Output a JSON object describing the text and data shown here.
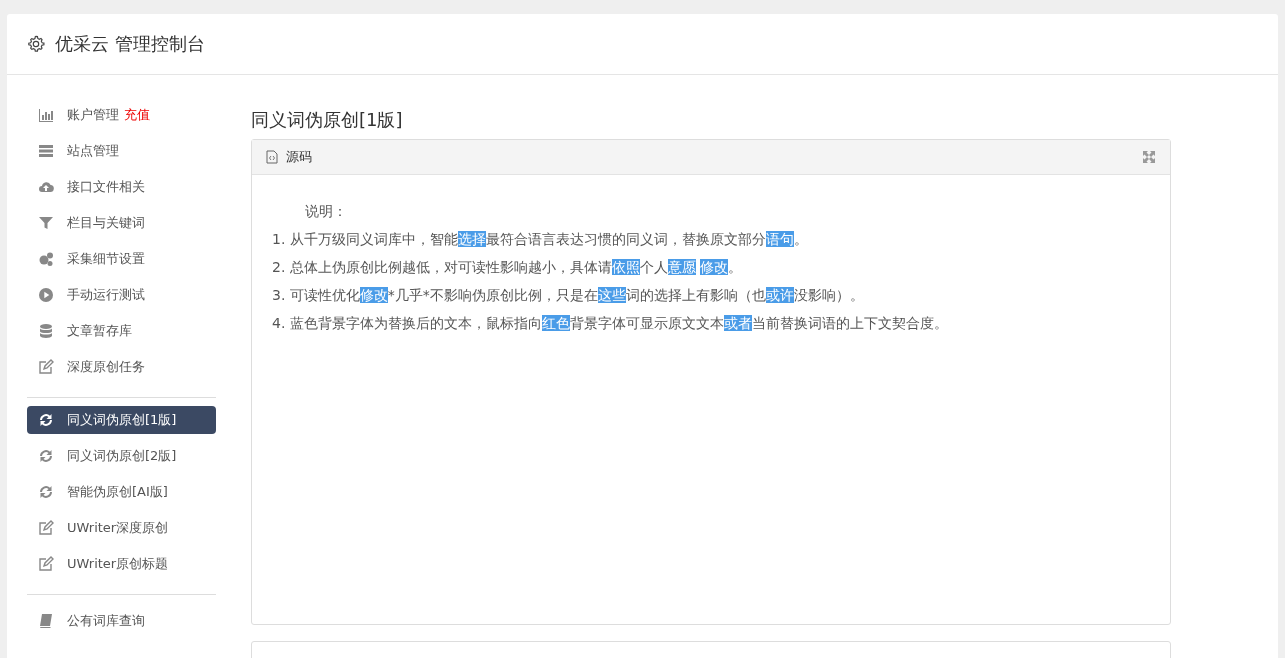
{
  "header": {
    "title": "优采云 管理控制台"
  },
  "sidebar": {
    "groups": [
      {
        "items": [
          {
            "label": "账户管理",
            "badge": "充值",
            "selected": false
          },
          {
            "label": "站点管理",
            "selected": false
          },
          {
            "label": "接口文件相关",
            "selected": false
          },
          {
            "label": "栏目与关键词",
            "selected": false
          },
          {
            "label": "采集细节设置",
            "selected": false
          },
          {
            "label": "手动运行测试",
            "selected": false
          },
          {
            "label": "文章暂存库",
            "selected": false
          },
          {
            "label": "深度原创任务",
            "selected": false
          }
        ]
      },
      {
        "items": [
          {
            "label": "同义词伪原创[1版]",
            "selected": true
          },
          {
            "label": "同义词伪原创[2版]",
            "selected": false
          },
          {
            "label": "智能伪原创[AI版]",
            "selected": false
          },
          {
            "label": "UWriter深度原创",
            "selected": false
          },
          {
            "label": "UWriter原创标题",
            "selected": false
          }
        ]
      },
      {
        "items": [
          {
            "label": "公有词库查询",
            "selected": false
          }
        ]
      }
    ]
  },
  "main": {
    "title": "同义词伪原创[1版]",
    "panel": {
      "title": "源码",
      "heading": "说明：",
      "lines": [
        [
          {
            "text": "1. 从千万级同义词库中，智能",
            "highlighted": false
          },
          {
            "text": "选择",
            "highlighted": true
          },
          {
            "text": "最符合语言表达习惯的同义词，替换原文部分",
            "highlighted": false
          },
          {
            "text": "语句",
            "highlighted": true
          },
          {
            "text": "。",
            "highlighted": false
          }
        ],
        [
          {
            "text": "2. 总体上伪原创比例越低，对可读性影响越小，具体请",
            "highlighted": false
          },
          {
            "text": "依照",
            "highlighted": true
          },
          {
            "text": "个人",
            "highlighted": false
          },
          {
            "text": "意愿",
            "highlighted": true
          },
          {
            "text": "修改",
            "highlighted": true
          },
          {
            "text": "。",
            "highlighted": false
          }
        ],
        [
          {
            "text": "3. 可读性优化",
            "highlighted": false
          },
          {
            "text": "修改",
            "highlighted": true
          },
          {
            "text": "*几乎*不影响伪原创比例，只是在",
            "highlighted": false
          },
          {
            "text": "这些",
            "highlighted": true
          },
          {
            "text": "词的选择上有影响（也",
            "highlighted": false
          },
          {
            "text": "或许",
            "highlighted": true
          },
          {
            "text": "没影响）。",
            "highlighted": false
          }
        ],
        [
          {
            "text": "4. 蓝色背景字体为替换后的文本，鼠标指向",
            "highlighted": false
          },
          {
            "text": "红色",
            "highlighted": true
          },
          {
            "text": "背景字体可显示原文文本",
            "highlighted": false
          },
          {
            "text": "或者",
            "highlighted": true
          },
          {
            "text": "当前替换词语的上下文契合度。",
            "highlighted": false
          }
        ]
      ]
    }
  }
}
